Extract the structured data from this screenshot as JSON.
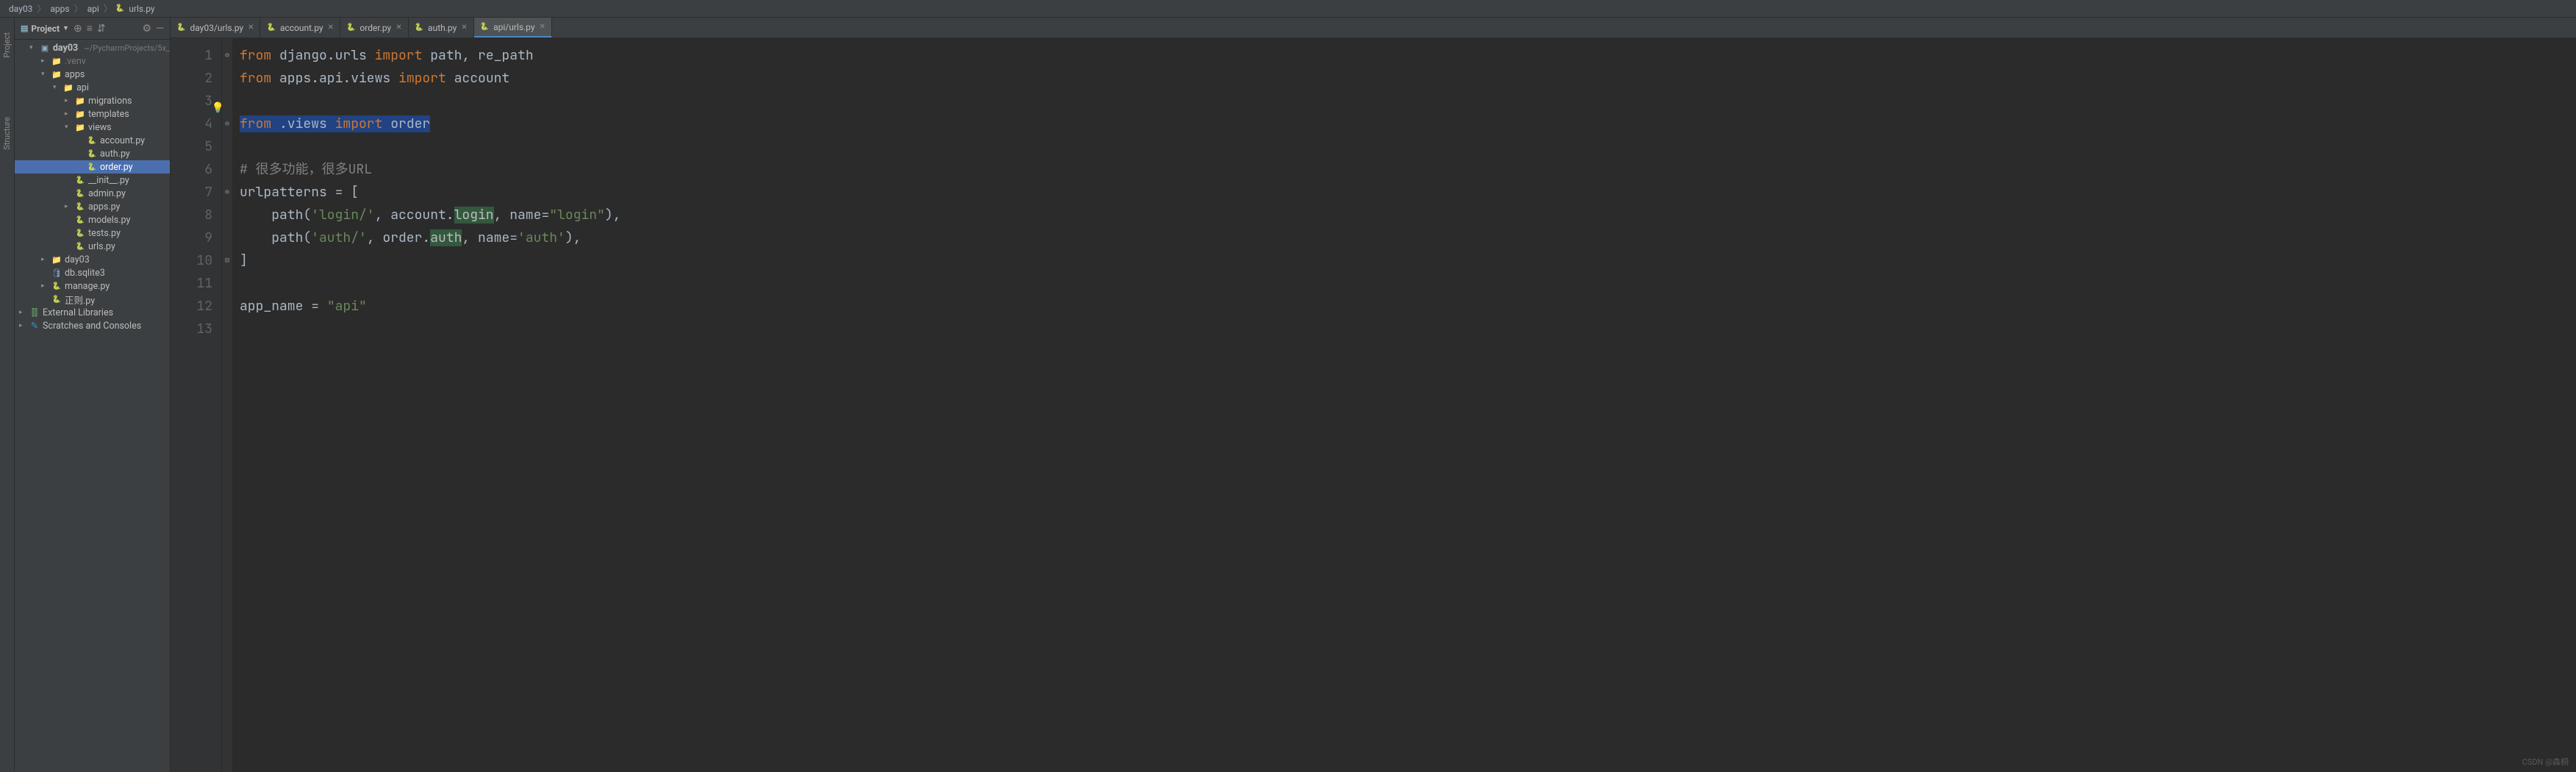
{
  "breadcrumb": [
    "day03",
    "apps",
    "api",
    "urls.py"
  ],
  "side_tabs": {
    "project": "Project",
    "structure": "Structure"
  },
  "project_panel": {
    "title": "Project",
    "root": {
      "name": "day03",
      "hint": "~/PycharmProjects/5x_"
    },
    "tree": [
      {
        "name": ".venv",
        "ico": "dir-orange",
        "ind": 2,
        "chev": ">",
        "muted": true
      },
      {
        "name": "apps",
        "ico": "dir",
        "ind": 2,
        "chev": "v"
      },
      {
        "name": "api",
        "ico": "dir",
        "ind": 3,
        "chev": "v"
      },
      {
        "name": "migrations",
        "ico": "dir",
        "ind": 4,
        "chev": ">"
      },
      {
        "name": "templates",
        "ico": "dir",
        "ind": 4,
        "chev": ">"
      },
      {
        "name": "views",
        "ico": "dir",
        "ind": 4,
        "chev": "v"
      },
      {
        "name": "account.py",
        "ico": "py",
        "ind": 5
      },
      {
        "name": "auth.py",
        "ico": "py",
        "ind": 5
      },
      {
        "name": "order.py",
        "ico": "py",
        "ind": 5,
        "selected": true
      },
      {
        "name": "__init__.py",
        "ico": "py",
        "ind": 4
      },
      {
        "name": "admin.py",
        "ico": "py",
        "ind": 4
      },
      {
        "name": "apps.py",
        "ico": "py",
        "ind": 4,
        "chev": ">"
      },
      {
        "name": "models.py",
        "ico": "py",
        "ind": 4
      },
      {
        "name": "tests.py",
        "ico": "py",
        "ind": 4
      },
      {
        "name": "urls.py",
        "ico": "py",
        "ind": 4
      },
      {
        "name": "day03",
        "ico": "dir",
        "ind": 2,
        "chev": ">"
      },
      {
        "name": "db.sqlite3",
        "ico": "db",
        "ind": 2
      },
      {
        "name": "manage.py",
        "ico": "py",
        "ind": 2,
        "chev": ">"
      },
      {
        "name": "正则.py",
        "ico": "py",
        "ind": 2
      }
    ],
    "ext_libs": "External Libraries",
    "scratches": "Scratches and Consoles"
  },
  "editor_tabs": [
    {
      "label": "day03/urls.py",
      "active": false
    },
    {
      "label": "account.py",
      "active": false
    },
    {
      "label": "order.py",
      "active": false
    },
    {
      "label": "auth.py",
      "active": false
    },
    {
      "label": "api/urls.py",
      "active": true
    }
  ],
  "code": {
    "line_count": 13,
    "lines": {
      "l1": {
        "a": "from",
        "b": " django.urls ",
        "c": "import",
        "d": " path",
        "e": ", ",
        "f": "re_path"
      },
      "l2": {
        "a": "from",
        "b": " apps.api.views ",
        "c": "import",
        "d": " account"
      },
      "l4": {
        "a": "from",
        "b": " .views ",
        "c": "import",
        "d": " order"
      },
      "l6": "# 很多功能，很多URL",
      "l7": "urlpatterns = [",
      "l8": {
        "a": "    path(",
        "s1": "'login/'",
        "b": ", account.",
        "h": "login",
        "c": ", name=",
        "s2": "\"login\"",
        "d": "),"
      },
      "l9": {
        "a": "    path(",
        "s1": "'auth/'",
        "b": ", order.",
        "h": "auth",
        "c": ", name=",
        "s2": "'auth'",
        "d": "),"
      },
      "l10": "]",
      "l12": {
        "a": "app_name = ",
        "s": "\"api\""
      }
    }
  },
  "watermark": "CSDN @森桐"
}
